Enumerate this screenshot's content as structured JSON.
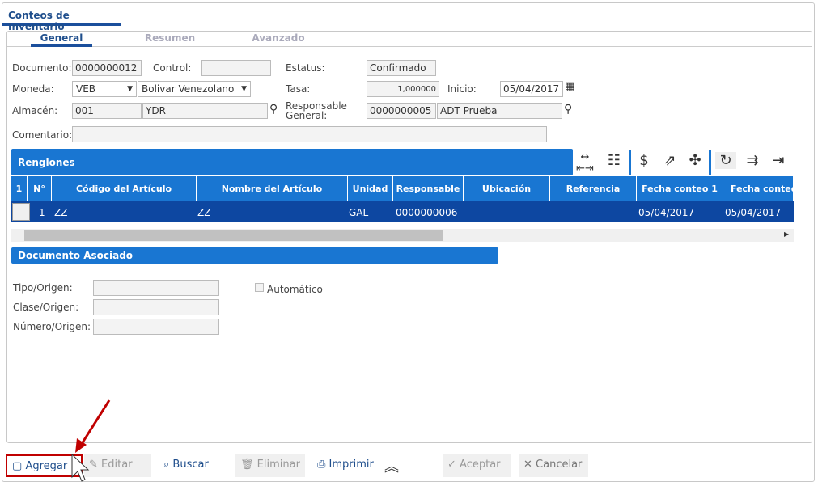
{
  "window": {
    "title": "Conteos de Inventario"
  },
  "tabs": [
    "General",
    "Resumen",
    "Avanzado"
  ],
  "form": {
    "documento_label": "Documento:",
    "documento": "0000000012",
    "control_label": "Control:",
    "control": "",
    "estatus_label": "Estatus:",
    "estatus": "Confirmado",
    "moneda_label": "Moneda:",
    "moneda": "VEB",
    "moneda_nombre": "Bolivar Venezolano",
    "tasa_label": "Tasa:",
    "tasa": "1,000000",
    "inicio_label": "Inicio:",
    "inicio": "05/04/2017",
    "almacen_label": "Almacén:",
    "almacen": "001",
    "almacen_nombre": "YDR",
    "responsable_label1": "Responsable",
    "responsable_label2": "General:",
    "responsable": "0000000005",
    "responsable_nombre": "ADT Prueba",
    "comentario_label": "Comentario:",
    "comentario": ""
  },
  "renglones": {
    "title": "Renglones",
    "columns": [
      "1",
      "N°",
      "Código del Artículo",
      "Nombre del Artículo",
      "Unidad",
      "Responsable",
      "Ubicación",
      "Referencia",
      "Fecha conteo 1",
      "Fecha conteo"
    ],
    "rows": [
      {
        "n": "1",
        "codigo": "ZZ",
        "nombre": "ZZ",
        "unidad": "GAL",
        "responsable": "0000000006",
        "ubicacion": "",
        "referencia": "",
        "fecha1": "05/04/2017",
        "fecha2": "05/04/2017"
      }
    ]
  },
  "asociado": {
    "title": "Documento Asociado",
    "tipo_label": "Tipo/Origen:",
    "clase_label": "Clase/Origen:",
    "numero_label": "Número/Origen:",
    "automatico_label": "Automático"
  },
  "toolbar": {
    "agregar": "Agregar",
    "editar": "Editar",
    "buscar": "Buscar",
    "eliminar": "Eliminar",
    "imprimir": "Imprimir",
    "aceptar": "Aceptar",
    "cancelar": "Cancelar"
  },
  "colors": {
    "accent": "#1976d2",
    "row": "#0d47a1",
    "highlight": "#c00000"
  }
}
